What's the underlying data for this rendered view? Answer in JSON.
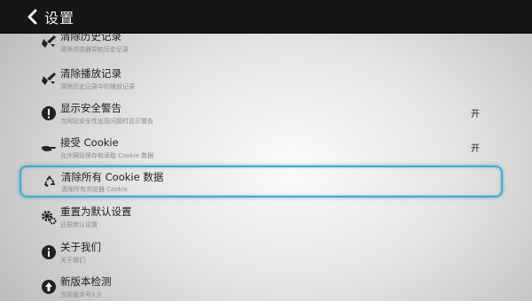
{
  "header": {
    "back_icon": "chevron-left-icon",
    "title": "设置"
  },
  "settings": [
    {
      "label": "清除历史记录",
      "sub": "清除浏览器导航历史记录",
      "value": "",
      "icon": "broom-icon"
    },
    {
      "label": "清除播放记录",
      "sub": "清除历史记录中的播放记录",
      "value": "",
      "icon": "broom-icon"
    },
    {
      "label": "显示安全警告",
      "sub": "当网站安全性出现问题时显示警告",
      "value": "开",
      "icon": "warning-icon"
    },
    {
      "label": "接受 Cookie",
      "sub": "允许网站保存和读取 Cookie 数据",
      "value": "开",
      "icon": "hand-icon"
    },
    {
      "label": "清除所有 Cookie 数据",
      "sub": "清除所有浏览器 Cookie",
      "value": "",
      "icon": "recycle-icon"
    },
    {
      "label": "重置为默认设置",
      "sub": "还原默认设置",
      "value": "",
      "icon": "gear-icon"
    },
    {
      "label": "关于我们",
      "sub": "关于我们",
      "value": "",
      "icon": "info-icon"
    },
    {
      "label": "新版本检测",
      "sub": "当前版本号1.0",
      "value": "",
      "icon": "update-icon"
    }
  ],
  "colors": {
    "topbar": "#161616",
    "highlight": "#4aa9cc",
    "label": "#1d1d1d",
    "sub": "#8a8a8a"
  }
}
